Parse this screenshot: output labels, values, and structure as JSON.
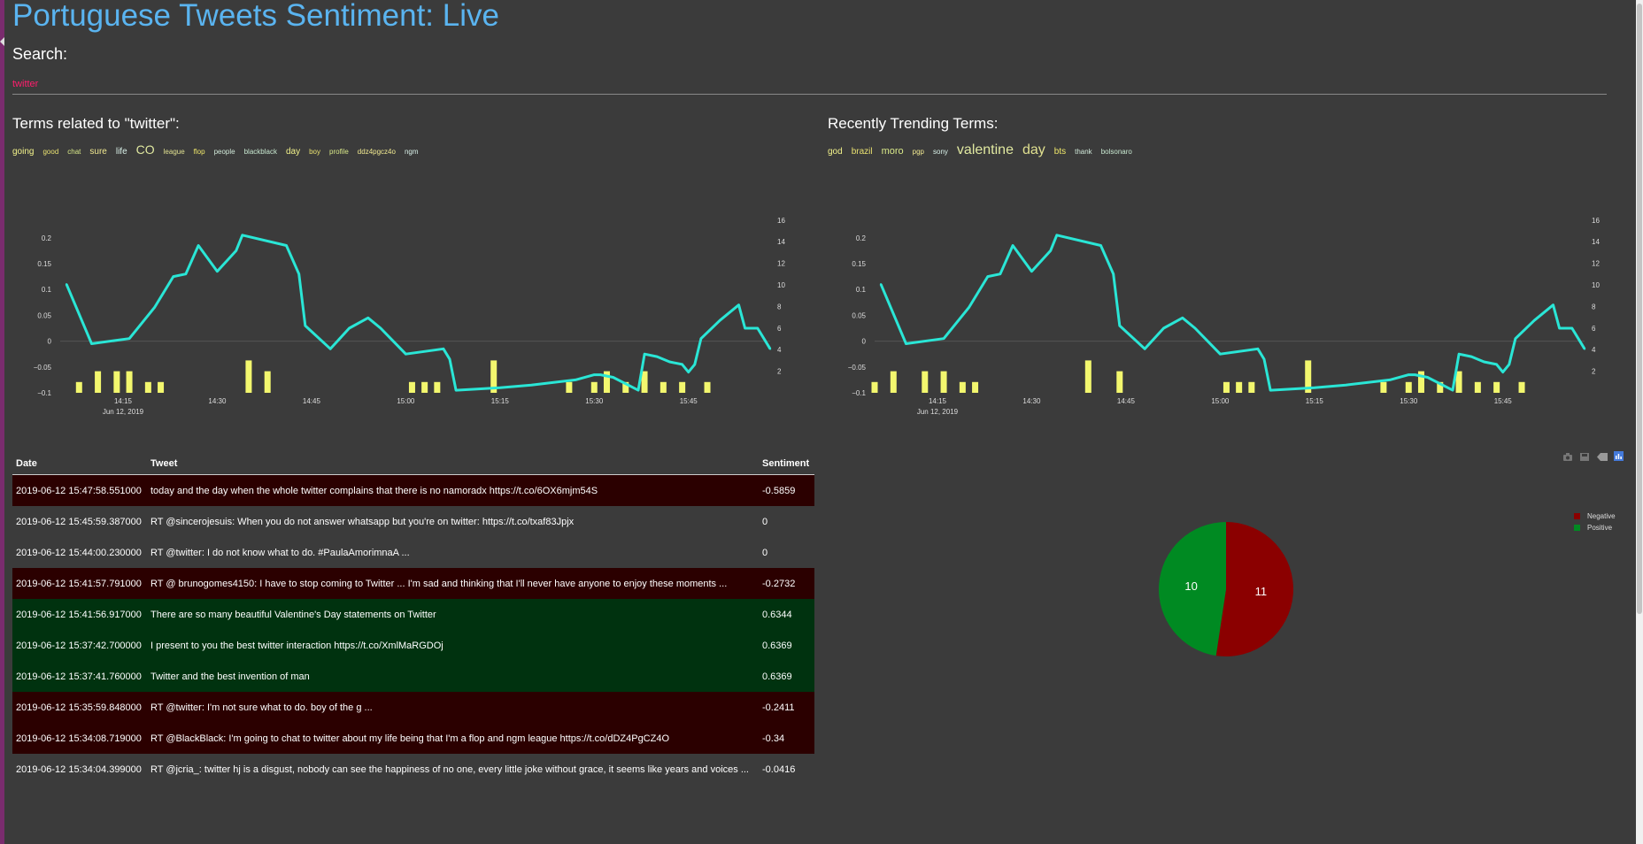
{
  "header": {
    "title": "Portuguese Tweets Sentiment: Live"
  },
  "search": {
    "label": "Search:",
    "value": "twitter"
  },
  "related": {
    "title": "Terms related to \"twitter\":",
    "terms": [
      {
        "text": "going",
        "size": 10
      },
      {
        "text": "good",
        "size": 8
      },
      {
        "text": "chat",
        "size": 8
      },
      {
        "text": "sure",
        "size": 10
      },
      {
        "text": "life",
        "size": 10
      },
      {
        "text": "CO",
        "size": 14
      },
      {
        "text": "league",
        "size": 8
      },
      {
        "text": "flop",
        "size": 8
      },
      {
        "text": "people",
        "size": 8
      },
      {
        "text": "blackblack",
        "size": 8
      },
      {
        "text": "day",
        "size": 10
      },
      {
        "text": "boy",
        "size": 8
      },
      {
        "text": "profile",
        "size": 8
      },
      {
        "text": "ddz4pgcz4o",
        "size": 8
      },
      {
        "text": "ngm",
        "size": 8
      }
    ]
  },
  "trending": {
    "title": "Recently Trending Terms:",
    "terms": [
      {
        "text": "god",
        "size": 10
      },
      {
        "text": "brazil",
        "size": 10
      },
      {
        "text": "moro",
        "size": 11
      },
      {
        "text": "pgp",
        "size": 8
      },
      {
        "text": "sony",
        "size": 8
      },
      {
        "text": "valentine",
        "size": 16
      },
      {
        "text": "day",
        "size": 16
      },
      {
        "text": "bts",
        "size": 10
      },
      {
        "text": "thank",
        "size": 8
      },
      {
        "text": "bolsonaro",
        "size": 8
      }
    ]
  },
  "colors": {
    "term_palette": [
      "#f2f28a",
      "#e8e070",
      "#d8e888",
      "#f0e890",
      "#d8f0e8",
      "#e0e8a0",
      "#e0e090",
      "#f0e86a",
      "#d0e8d8",
      "#c8e8d0"
    ],
    "line": "#2ae6d6",
    "bar": "#f3f76e",
    "negative_row": "#2b0000",
    "positive_row": "#00320f",
    "neutral_row": "#3b3b3b",
    "negative": "#8b0000",
    "positive": "#008a22"
  },
  "chart_data": [
    {
      "type": "line",
      "series": [
        {
          "values": [
            0.11,
            -0.005,
            0.005,
            0.065,
            0.125,
            0.13,
            0.185,
            0.135,
            0.175,
            0.205,
            0.185,
            0.13,
            0.03,
            -0.015,
            0.025,
            0.045,
            0.025,
            -0.025,
            -0.015,
            -0.035,
            -0.095,
            -0.09,
            -0.085,
            -0.075,
            -0.065,
            -0.065,
            -0.07,
            -0.095,
            -0.025,
            -0.03,
            -0.04,
            -0.045,
            -0.06,
            -0.045,
            0.005,
            0.04,
            0.07,
            0.025,
            0.025,
            -0.015
          ],
          "x": [
            "14:06",
            "14:10",
            "14:16",
            "14:20",
            "14:23",
            "14:25",
            "14:27",
            "14:30",
            "14:33",
            "14:34",
            "14:41",
            "14:43",
            "14:44",
            "14:48",
            "14:51",
            "14:54",
            "14:56",
            "15:00",
            "15:06",
            "15:07",
            "15:08",
            "15:15",
            "15:20",
            "15:27",
            "15:30",
            "15:31",
            "15:33",
            "15:37",
            "15:38",
            "15:40",
            "15:42",
            "15:44",
            "15:45",
            "15:46",
            "15:47",
            "15:50",
            "15:53",
            "15:54",
            "15:56",
            "15:58"
          ]
        }
      ],
      "bars": {
        "x": [
          "14:08",
          "14:11",
          "14:14",
          "14:16",
          "14:19",
          "14:21",
          "14:35",
          "14:38",
          "15:01",
          "15:03",
          "15:05",
          "15:14",
          "15:26",
          "15:30",
          "15:32",
          "15:35",
          "15:38",
          "15:41",
          "15:44",
          "15:48"
        ],
        "values": [
          1,
          2,
          2,
          2,
          1,
          1,
          3,
          2,
          1,
          1,
          1,
          3,
          1,
          1,
          2,
          1,
          2,
          1,
          1,
          1
        ]
      },
      "x_ticks": [
        "14:15",
        "14:30",
        "14:45",
        "15:00",
        "15:15",
        "15:30",
        "15:45"
      ],
      "x_date": "Jun 12, 2019",
      "y_ticks": [
        "−0.1",
        "−0.05",
        "0",
        "0.05",
        "0.1",
        "0.15",
        "0.2"
      ],
      "y2_ticks": [
        "2",
        "4",
        "6",
        "8",
        "10",
        "12",
        "14",
        "16"
      ]
    },
    {
      "type": "line",
      "series": [
        {
          "values": [
            0.11,
            -0.005,
            0.005,
            0.065,
            0.125,
            0.13,
            0.185,
            0.135,
            0.175,
            0.205,
            0.185,
            0.13,
            0.03,
            -0.015,
            0.025,
            0.045,
            0.025,
            -0.025,
            -0.015,
            -0.035,
            -0.095,
            -0.09,
            -0.085,
            -0.075,
            -0.065,
            -0.065,
            -0.07,
            -0.095,
            -0.025,
            -0.03,
            -0.04,
            -0.045,
            -0.06,
            -0.045,
            0.005,
            0.04,
            0.07,
            0.025,
            0.025,
            -0.015
          ],
          "x": [
            "14:06",
            "14:10",
            "14:16",
            "14:20",
            "14:23",
            "14:25",
            "14:27",
            "14:30",
            "14:33",
            "14:34",
            "14:41",
            "14:43",
            "14:44",
            "14:48",
            "14:51",
            "14:54",
            "14:56",
            "15:00",
            "15:06",
            "15:07",
            "15:08",
            "15:15",
            "15:20",
            "15:27",
            "15:30",
            "15:31",
            "15:33",
            "15:37",
            "15:38",
            "15:40",
            "15:42",
            "15:44",
            "15:45",
            "15:46",
            "15:47",
            "15:50",
            "15:53",
            "15:54",
            "15:56",
            "15:58"
          ]
        }
      ],
      "bars": {
        "x": [
          "14:05",
          "14:08",
          "14:13",
          "14:16",
          "14:19",
          "14:21",
          "14:39",
          "14:44",
          "15:01",
          "15:03",
          "15:05",
          "15:14",
          "15:26",
          "15:30",
          "15:32",
          "15:35",
          "15:38",
          "15:41",
          "15:44",
          "15:48"
        ],
        "values": [
          1,
          2,
          2,
          2,
          1,
          1,
          3,
          2,
          1,
          1,
          1,
          3,
          1,
          1,
          2,
          1,
          2,
          1,
          1,
          1
        ]
      },
      "x_ticks": [
        "14:15",
        "14:30",
        "14:45",
        "15:00",
        "15:15",
        "15:30",
        "15:45"
      ],
      "x_date": "Jun 12, 2019",
      "y_ticks": [
        "−0.1",
        "−0.05",
        "0",
        "0.05",
        "0.1",
        "0.15",
        "0.2"
      ],
      "y2_ticks": [
        "2",
        "4",
        "6",
        "8",
        "10",
        "12",
        "14",
        "16"
      ]
    },
    {
      "type": "pie",
      "labels": [
        "Negative",
        "Positive"
      ],
      "values": [
        11,
        10
      ],
      "colors": [
        "#8b0000",
        "#008a22"
      ],
      "legend_position": "top-right"
    }
  ],
  "table": {
    "headers": [
      "Date",
      "Tweet",
      "Sentiment"
    ],
    "rows": [
      {
        "date": "2019-06-12 15:47:58.551000",
        "tweet": "today and the day when the whole twitter complains that there is no namoradx https://t.co/6OX6mjm54S",
        "sentiment": "-0.5859",
        "class": "negative"
      },
      {
        "date": "2019-06-12 15:45:59.387000",
        "tweet": "RT @sincerojesuis: When you do not answer whatsapp but you're on twitter: https://t.co/txaf83Jpjx",
        "sentiment": "0",
        "class": "neutral"
      },
      {
        "date": "2019-06-12 15:44:00.230000",
        "tweet": "RT @twitter: I do not know what to do. #PaulaAmorimnaA ...",
        "sentiment": "0",
        "class": "neutral"
      },
      {
        "date": "2019-06-12 15:41:57.791000",
        "tweet": "RT @ brunogomes4150: I have to stop coming to Twitter ... I'm sad and thinking that I'll never have anyone to enjoy these moments ...",
        "sentiment": "-0.2732",
        "class": "negative"
      },
      {
        "date": "2019-06-12 15:41:56.917000",
        "tweet": "There are so many beautiful Valentine's Day statements on Twitter",
        "sentiment": "0.6344",
        "class": "positive"
      },
      {
        "date": "2019-06-12 15:37:42.700000",
        "tweet": "I present to you the best twitter interaction https://t.co/XmlMaRGDOj",
        "sentiment": "0.6369",
        "class": "positive"
      },
      {
        "date": "2019-06-12 15:37:41.760000",
        "tweet": "Twitter and the best invention of man",
        "sentiment": "0.6369",
        "class": "positive"
      },
      {
        "date": "2019-06-12 15:35:59.848000",
        "tweet": "RT @twitter: I'm not sure what to do. boy of the g ...",
        "sentiment": "-0.2411",
        "class": "negative"
      },
      {
        "date": "2019-06-12 15:34:08.719000",
        "tweet": "RT @BlackBlack: I'm going to chat to twitter about my life being that I'm a flop and ngm league https://t.co/dDZ4PgCZ4O",
        "sentiment": "-0.34",
        "class": "negative"
      },
      {
        "date": "2019-06-12 15:34:04.399000",
        "tweet": "RT @jcria_: twitter hj is a disgust, nobody can see the happiness of no one, every little joke without grace, it seems like years and voices ...",
        "sentiment": "-0.0416",
        "class": "neutral"
      }
    ]
  },
  "modebar": {
    "icons": [
      "camera-icon",
      "save-icon",
      "hover-compare-icon",
      "plotly-logo-icon"
    ]
  }
}
